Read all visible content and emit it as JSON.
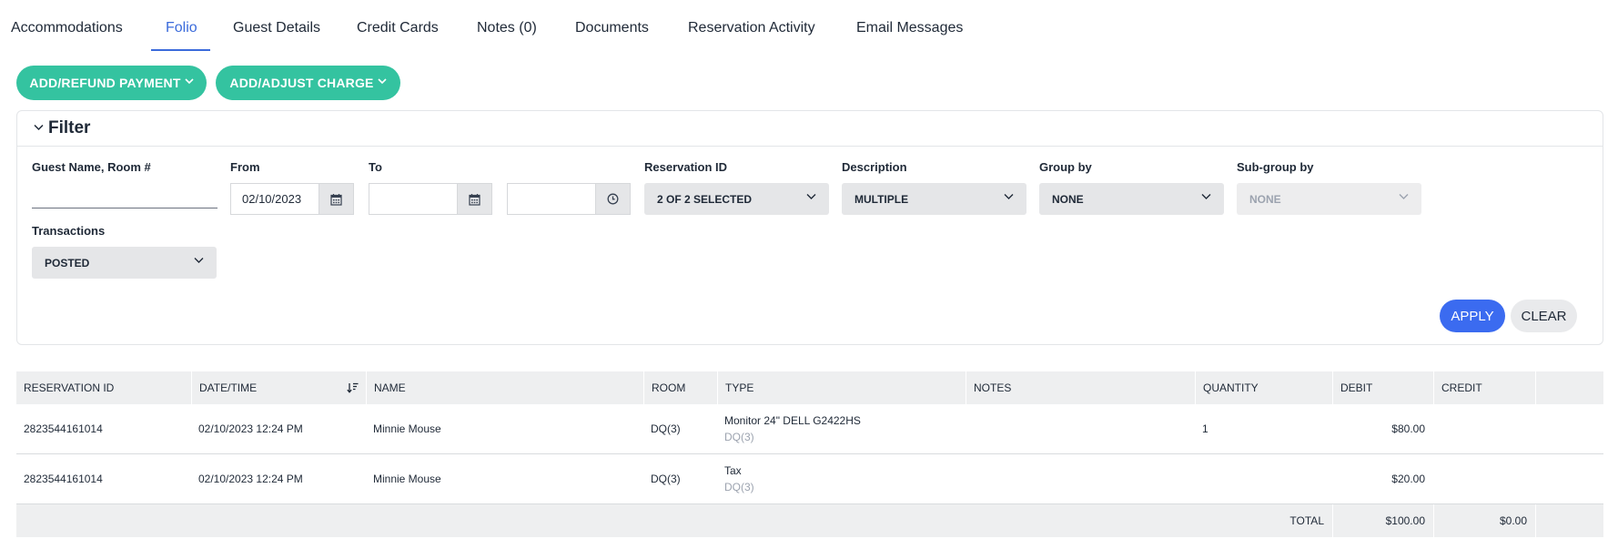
{
  "tabs": [
    {
      "label": "Accommodations",
      "active": false
    },
    {
      "label": "Folio",
      "active": true
    },
    {
      "label": "Guest Details",
      "active": false
    },
    {
      "label": "Credit Cards",
      "active": false
    },
    {
      "label": "Notes (0)",
      "active": false
    },
    {
      "label": "Documents",
      "active": false
    },
    {
      "label": "Reservation Activity",
      "active": false
    },
    {
      "label": "Email Messages",
      "active": false
    }
  ],
  "actions": {
    "add_refund_payment": "ADD/REFUND PAYMENT",
    "add_adjust_charge": "ADD/ADJUST CHARGE"
  },
  "filter": {
    "title": "Filter",
    "guest_label": "Guest Name, Room #",
    "guest_value": "",
    "from_label": "From",
    "from_value": "02/10/2023",
    "to_label": "To",
    "to_value": "",
    "time_value": "",
    "reservation_label": "Reservation ID",
    "reservation_value": "2 OF 2 SELECTED",
    "description_label": "Description",
    "description_value": "MULTIPLE",
    "groupby_label": "Group by",
    "groupby_value": "NONE",
    "subgroup_label": "Sub-group by",
    "subgroup_value": "NONE",
    "transactions_label": "Transactions",
    "transactions_value": "POSTED",
    "apply_label": "APPLY",
    "clear_label": "CLEAR"
  },
  "table": {
    "columns": [
      "RESERVATION ID",
      "DATE/TIME",
      "NAME",
      "ROOM",
      "TYPE",
      "NOTES",
      "QUANTITY",
      "DEBIT",
      "CREDIT"
    ],
    "rows": [
      {
        "reservation_id": "2823544161014",
        "datetime": "02/10/2023 12:24 PM",
        "name": "Minnie Mouse",
        "room": "DQ(3)",
        "type": "Monitor 24\" DELL G2422HS",
        "type_sub": "DQ(3)",
        "notes": "",
        "quantity": "1",
        "debit": "$80.00",
        "credit": ""
      },
      {
        "reservation_id": "2823544161014",
        "datetime": "02/10/2023 12:24 PM",
        "name": "Minnie Mouse",
        "room": "DQ(3)",
        "type": "Tax",
        "type_sub": "DQ(3)",
        "notes": "",
        "quantity": "",
        "debit": "$20.00",
        "credit": ""
      }
    ],
    "total_label": "TOTAL",
    "total_debit": "$100.00",
    "total_credit": "$0.00"
  },
  "colors": {
    "accent_blue": "#3b6bdb",
    "teal": "#34c3a0"
  },
  "icons": {
    "calendar": "calendar-icon",
    "clock": "clock-icon",
    "sort": "sort-icon",
    "chevron": "chevron-down-icon"
  }
}
